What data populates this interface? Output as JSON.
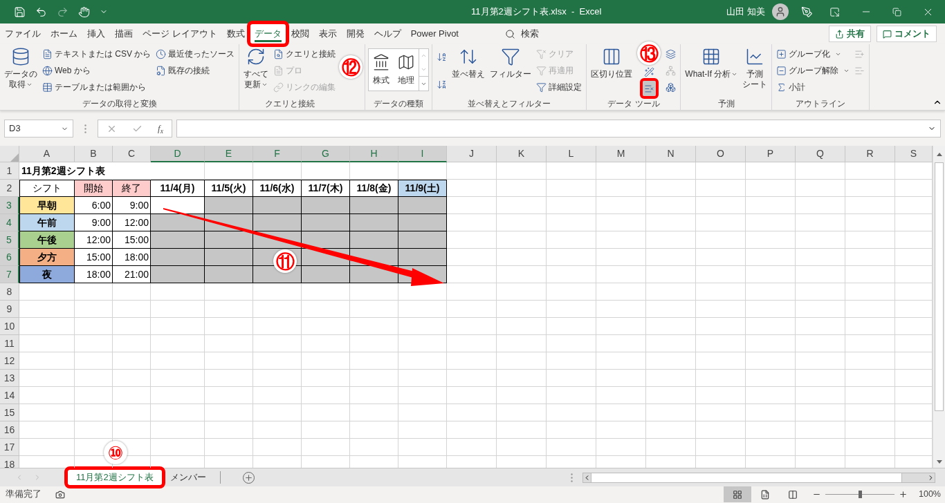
{
  "window": {
    "title": "11月第2週シフト表.xlsx  -  Excel",
    "user": "山田 知美"
  },
  "ribbon_tabs": [
    {
      "label": "ファイル",
      "selected": false,
      "highlighted": false
    },
    {
      "label": "ホーム",
      "selected": false,
      "highlighted": false
    },
    {
      "label": "挿入",
      "selected": false,
      "highlighted": false
    },
    {
      "label": "描画",
      "selected": false,
      "highlighted": false
    },
    {
      "label": "ページ レイアウト",
      "selected": false,
      "highlighted": false
    },
    {
      "label": "数式",
      "selected": false,
      "highlighted": false
    },
    {
      "label": "データ",
      "selected": true,
      "highlighted": true
    },
    {
      "label": "校閲",
      "selected": false,
      "highlighted": false
    },
    {
      "label": "表示",
      "selected": false,
      "highlighted": false
    },
    {
      "label": "開発",
      "selected": false,
      "highlighted": false
    },
    {
      "label": "ヘルプ",
      "selected": false,
      "highlighted": false
    },
    {
      "label": "Power Pivot",
      "selected": false,
      "highlighted": false
    }
  ],
  "search": {
    "placeholder": "検索"
  },
  "share_button": "共有",
  "comment_button": "コメント",
  "ribbon_groups": [
    {
      "label": "データの取得と変換",
      "items": [
        {
          "kind": "large",
          "lines": [
            "データの",
            "取得"
          ],
          "caret": true
        },
        {
          "kind": "stack",
          "entries": [
            {
              "text": "テキストまたは CSV から",
              "disabled": false,
              "highlighted": false
            },
            {
              "text": "Web から",
              "disabled": false,
              "highlighted": false
            },
            {
              "text": "テーブルまたは範囲から",
              "disabled": false,
              "highlighted": false
            }
          ]
        },
        {
          "kind": "stack",
          "entries": [
            {
              "text": "最近使ったソース",
              "disabled": false,
              "highlighted": false
            },
            {
              "text": "既存の接続",
              "disabled": false,
              "highlighted": false
            }
          ]
        }
      ]
    },
    {
      "label": "クエリと接続",
      "items": [
        {
          "kind": "large",
          "lines": [
            "すべて",
            "更新"
          ],
          "caret": true
        },
        {
          "kind": "stack",
          "entries": [
            {
              "text": "クエリと接続",
              "disabled": false,
              "highlighted": false
            },
            {
              "text": "プロ",
              "disabled": true,
              "highlighted": false
            },
            {
              "text": "リンクの編集",
              "disabled": true,
              "highlighted": false
            }
          ]
        }
      ]
    },
    {
      "label": "データの種類",
      "items": [
        {
          "kind": "gallery",
          "options": [
            "株式",
            "地理"
          ]
        }
      ]
    },
    {
      "label": "並べ替えとフィルター",
      "items": [
        {
          "kind": "stack",
          "entries": [
            {
              "disabled": false,
              "highlighted": false
            },
            {
              "disabled": false,
              "highlighted": false
            }
          ]
        },
        {
          "kind": "large",
          "lines": [
            "並べ替え"
          ],
          "caret": false
        },
        {
          "kind": "large",
          "lines": [
            "フィルター"
          ],
          "caret": false
        },
        {
          "kind": "stack",
          "entries": [
            {
              "text": "クリア",
              "disabled": true,
              "highlighted": false
            },
            {
              "text": "再適用",
              "disabled": true,
              "highlighted": false
            },
            {
              "text": "詳細設定",
              "disabled": false,
              "highlighted": false
            }
          ]
        }
      ]
    },
    {
      "label": "データ ツール",
      "items": [
        {
          "kind": "large",
          "lines": [
            "区切り位置"
          ],
          "caret": false
        },
        {
          "kind": "stack",
          "entries": [
            {
              "disabled": false,
              "highlighted": false
            },
            {
              "disabled": false,
              "highlighted": true
            }
          ]
        },
        {
          "kind": "stack",
          "entries": [
            {
              "disabled": false,
              "highlighted": false
            },
            {
              "disabled": true,
              "highlighted": false
            },
            {
              "disabled": false,
              "highlighted": false
            }
          ]
        }
      ]
    },
    {
      "label": "予測",
      "items": [
        {
          "kind": "large",
          "lines": [
            "What-If 分析"
          ],
          "caret": true
        },
        {
          "kind": "large",
          "lines": [
            "予測",
            "シート"
          ],
          "caret": false
        }
      ]
    },
    {
      "label": "アウトライン",
      "items": [
        {
          "kind": "stack",
          "entries": [
            {
              "text": "グループ化",
              "disabled": false,
              "highlighted": false,
              "caret": true
            },
            {
              "text": "グループ解除",
              "disabled": false,
              "highlighted": false,
              "caret": true
            },
            {
              "text": "小計",
              "disabled": false,
              "highlighted": false,
              "caret": false
            }
          ]
        },
        {
          "kind": "stack",
          "entries": [
            {
              "disabled": true,
              "highlighted": false
            },
            {
              "disabled": true,
              "highlighted": false
            }
          ]
        }
      ]
    }
  ],
  "formula_bar": {
    "name_box": "D3",
    "function_button": "f$_{x}$"
  },
  "columns": [
    {
      "label": "A",
      "selected": false
    },
    {
      "label": "B",
      "selected": false
    },
    {
      "label": "C",
      "selected": false
    },
    {
      "label": "D",
      "selected": true
    },
    {
      "label": "E",
      "selected": true
    },
    {
      "label": "F",
      "selected": true
    },
    {
      "label": "G",
      "selected": true
    },
    {
      "label": "H",
      "selected": true
    },
    {
      "label": "I",
      "selected": true
    },
    {
      "label": "J",
      "selected": false
    },
    {
      "label": "K",
      "selected": false
    },
    {
      "label": "L",
      "selected": false
    },
    {
      "label": "M",
      "selected": false
    },
    {
      "label": "N",
      "selected": false
    },
    {
      "label": "O",
      "selected": false
    },
    {
      "label": "P",
      "selected": false
    },
    {
      "label": "Q",
      "selected": false
    },
    {
      "label": "R",
      "selected": false
    },
    {
      "label": "S",
      "selected": false
    }
  ],
  "rows": [
    {
      "label": "1",
      "selected": false,
      "cells": [
        {
          "kind": "title",
          "text": "11月第2週シフト表",
          "selected": false
        }
      ]
    },
    {
      "label": "2",
      "selected": false,
      "cells": [
        {
          "kind": "head",
          "text": "シフト",
          "selected": false
        },
        {
          "kind": "head",
          "text": "開始",
          "color": "#ffcccc",
          "selected": false
        },
        {
          "kind": "head",
          "text": "終了",
          "color": "#ffcccc",
          "selected": false
        },
        {
          "kind": "date",
          "text": "11/4(月)",
          "selected": false
        },
        {
          "kind": "date",
          "text": "11/5(火)",
          "selected": false
        },
        {
          "kind": "date",
          "text": "11/6(水)",
          "selected": false
        },
        {
          "kind": "date",
          "text": "11/7(木)",
          "selected": false
        },
        {
          "kind": "date",
          "text": "11/8(金)",
          "selected": false
        },
        {
          "kind": "date",
          "text": "11/9(土)",
          "color": "#bdd7ee",
          "selected": false
        }
      ]
    },
    {
      "label": "3",
      "selected": true,
      "cells": [
        {
          "kind": "shift",
          "text": "早朝",
          "color": "#ffe699",
          "selected": false
        },
        {
          "kind": "time",
          "text": "6:00",
          "selected": false
        },
        {
          "kind": "time",
          "text": "9:00",
          "selected": false
        },
        {
          "kind": "blank",
          "active": true
        },
        {
          "kind": "blank",
          "selected": true
        },
        {
          "kind": "blank",
          "selected": true
        },
        {
          "kind": "blank",
          "selected": true
        },
        {
          "kind": "blank",
          "selected": true
        },
        {
          "kind": "blank",
          "selected": true
        }
      ]
    },
    {
      "label": "4",
      "selected": true,
      "cells": [
        {
          "kind": "shift",
          "text": "午前",
          "color": "#bdd7ee",
          "selected": false
        },
        {
          "kind": "time",
          "text": "9:00",
          "selected": false
        },
        {
          "kind": "time",
          "text": "12:00",
          "selected": false
        },
        {
          "kind": "blank",
          "selected": true
        },
        {
          "kind": "blank",
          "selected": true
        },
        {
          "kind": "blank",
          "selected": true
        },
        {
          "kind": "blank",
          "selected": true
        },
        {
          "kind": "blank",
          "selected": true
        },
        {
          "kind": "blank",
          "selected": true
        }
      ]
    },
    {
      "label": "5",
      "selected": true,
      "cells": [
        {
          "kind": "shift",
          "text": "午後",
          "color": "#a9d08e",
          "selected": false
        },
        {
          "kind": "time",
          "text": "12:00",
          "selected": false
        },
        {
          "kind": "time",
          "text": "15:00",
          "selected": false
        },
        {
          "kind": "blank",
          "selected": true
        },
        {
          "kind": "blank",
          "selected": true
        },
        {
          "kind": "blank",
          "selected": true
        },
        {
          "kind": "blank",
          "selected": true
        },
        {
          "kind": "blank",
          "selected": true
        },
        {
          "kind": "blank",
          "selected": true
        }
      ]
    },
    {
      "label": "6",
      "selected": true,
      "cells": [
        {
          "kind": "shift",
          "text": "夕方",
          "color": "#f4b084",
          "selected": false
        },
        {
          "kind": "time",
          "text": "15:00",
          "selected": false
        },
        {
          "kind": "time",
          "text": "18:00",
          "selected": false
        },
        {
          "kind": "blank",
          "selected": true
        },
        {
          "kind": "blank",
          "selected": true
        },
        {
          "kind": "blank",
          "selected": true
        },
        {
          "kind": "blank",
          "selected": true
        },
        {
          "kind": "blank",
          "selected": true
        },
        {
          "kind": "blank",
          "selected": true
        }
      ]
    },
    {
      "label": "7",
      "selected": true,
      "cells": [
        {
          "kind": "shift",
          "text": "夜",
          "color": "#8ea9db",
          "selected": false
        },
        {
          "kind": "time",
          "text": "18:00",
          "selected": false
        },
        {
          "kind": "time",
          "text": "21:00",
          "selected": false
        },
        {
          "kind": "blank",
          "selected": true
        },
        {
          "kind": "blank",
          "selected": true
        },
        {
          "kind": "blank",
          "selected": true
        },
        {
          "kind": "blank",
          "selected": true
        },
        {
          "kind": "blank",
          "selected": true
        },
        {
          "kind": "blank",
          "selected": true
        }
      ]
    },
    {
      "label": "8",
      "selected": false
    },
    {
      "label": "9",
      "selected": false
    },
    {
      "label": "10",
      "selected": false
    },
    {
      "label": "11",
      "selected": false
    },
    {
      "label": "12",
      "selected": false
    },
    {
      "label": "13",
      "selected": false
    },
    {
      "label": "14",
      "selected": false
    },
    {
      "label": "15",
      "selected": false
    },
    {
      "label": "16",
      "selected": false
    },
    {
      "label": "17",
      "selected": false
    },
    {
      "label": "18",
      "selected": false
    }
  ],
  "sheet_tabs": [
    {
      "label": "11月第2週シフト表",
      "selected": true,
      "highlighted": true
    },
    {
      "label": "メンバー",
      "selected": false,
      "highlighted": false
    }
  ],
  "status_bar": {
    "text": "準備完了",
    "zoom": {
      "level": 0.5,
      "reading": "100%"
    },
    "views": [
      {
        "selected": true
      },
      {
        "selected": false
      },
      {
        "selected": false
      }
    ]
  },
  "callouts": [
    {
      "label": "⑫"
    },
    {
      "label": "⑬"
    },
    {
      "label": "⑪"
    },
    {
      "label": "⑩"
    }
  ]
}
